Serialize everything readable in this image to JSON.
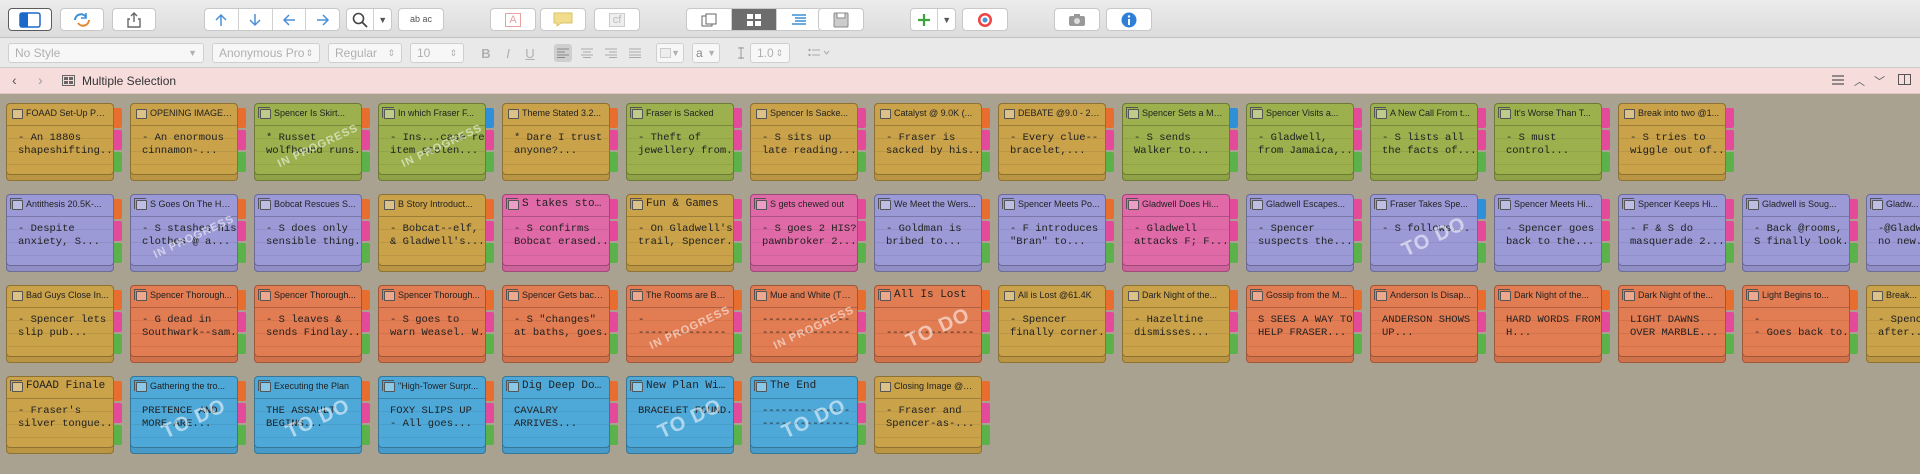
{
  "toolbar": {
    "find_replace_label": "ab ac",
    "text_color_label": "A",
    "comment_label": "",
    "footnote_label": "cf"
  },
  "formatbar": {
    "style": "No Style",
    "font": "Anonymous Pro",
    "weight": "Regular",
    "size": "10",
    "line_spacing": "1.0",
    "bold": "B",
    "italic": "I",
    "underline": "U",
    "color_label": "a"
  },
  "navbar": {
    "title": "Multiple Selection"
  },
  "colors": {
    "yellow": "#c9a24a",
    "green": "#9cb04e",
    "purple": "#9b9ad6",
    "pink": "#e06aa8",
    "orange": "#e27c52",
    "blue": "#4ea9d9",
    "tab_orange": "#e76e2e",
    "tab_pink": "#e34b9a",
    "tab_green": "#5bb24a",
    "tab_blue": "#2f8fd8"
  },
  "cards": [
    [
      {
        "title": "FOAAD Set-Up Part...",
        "text": "- An 1880s\nshapeshifting...",
        "color": "yellow",
        "stamp": "",
        "big": false,
        "tabs": [
          "tab_orange",
          "tab_pink",
          "tab_green"
        ]
      },
      {
        "title": "OPENING IMAGE (Th...",
        "text": "- An enormous\ncinnamon-...",
        "color": "yellow",
        "stamp": "",
        "big": false,
        "tabs": [
          "tab_orange",
          "tab_pink",
          "tab_green"
        ]
      },
      {
        "title": "Spencer Is Skirt...",
        "text": "* Russet\nwolfhound runs...",
        "color": "green",
        "stamp": "IN PROGRESS",
        "big": false,
        "tabs": [
          "tab_orange",
          "tab_pink",
          "tab_green"
        ]
      },
      {
        "title": "In which Fraser F...",
        "text": "- Ins...case re:\nitem stolen...",
        "color": "green",
        "stamp": "IN PROGRESS",
        "big": false,
        "tabs": [
          "tab_blue",
          "tab_pink",
          "tab_green"
        ]
      },
      {
        "title": "Theme Stated 3.2...",
        "text": "* Dare I trust\nanyone?...",
        "color": "yellow",
        "stamp": "",
        "big": false,
        "tabs": [
          "tab_orange",
          "tab_pink",
          "tab_green"
        ]
      },
      {
        "title": "Fraser is Sacked",
        "text": "- Theft of\njewellery from...",
        "color": "green",
        "stamp": "",
        "big": false,
        "tabs": [
          "tab_pink",
          "tab_pink",
          "tab_green"
        ]
      },
      {
        "title": "Spencer Is Sacke...",
        "text": "- S sits up\nlate reading...",
        "color": "yellow",
        "stamp": "",
        "big": false,
        "tabs": [
          "tab_pink",
          "tab_pink",
          "tab_green"
        ]
      },
      {
        "title": "Catalyst @ 9.0K (...",
        "text": "- Fraser is\nsacked by his...",
        "color": "yellow",
        "stamp": "",
        "big": false,
        "tabs": [
          "tab_orange",
          "tab_pink",
          "tab_green"
        ]
      },
      {
        "title": "DEBATE @9.0 - 20...",
        "text": "- Every clue--\nbracelet,...",
        "color": "yellow",
        "stamp": "",
        "big": false,
        "tabs": [
          "tab_orange",
          "tab_pink",
          "tab_green"
        ]
      },
      {
        "title": "Spencer Sets a Mo...",
        "text": "- S sends\nWalker to...",
        "color": "green",
        "stamp": "",
        "big": false,
        "tabs": [
          "tab_blue",
          "tab_pink",
          "tab_green"
        ]
      },
      {
        "title": "Spencer Visits a...",
        "text": "- Gladwell,\nfrom Jamaica,...",
        "color": "green",
        "stamp": "",
        "big": false,
        "tabs": [
          "tab_pink",
          "tab_pink",
          "tab_green"
        ]
      },
      {
        "title": "A New Call From t...",
        "text": "- S lists all\nthe facts of...",
        "color": "green",
        "stamp": "",
        "big": false,
        "tabs": [
          "tab_pink",
          "tab_pink",
          "tab_green"
        ]
      },
      {
        "title": "It's Worse Than T...",
        "text": "- S must\ncontrol...",
        "color": "green",
        "stamp": "",
        "big": false,
        "tabs": [
          "tab_pink",
          "tab_pink",
          "tab_green"
        ]
      },
      {
        "title": "Break into two @1...",
        "text": "- S tries to\nwiggle out of...",
        "color": "yellow",
        "stamp": "",
        "big": false,
        "tabs": [
          "tab_pink",
          "tab_pink",
          "tab_green"
        ]
      }
    ],
    [
      {
        "title": "Antithesis 20.5K-...",
        "text": "- Despite\nanxiety, S...",
        "color": "purple",
        "stamp": "",
        "big": false,
        "tabs": [
          "tab_orange",
          "tab_pink",
          "tab_green"
        ]
      },
      {
        "title": "S Goes On The Hu...",
        "text": "- S stashes his\nclothes @ a...",
        "color": "purple",
        "stamp": "IN PROGRESS",
        "big": false,
        "tabs": [
          "tab_orange",
          "tab_pink",
          "tab_green"
        ]
      },
      {
        "title": "Bobcat Rescues S...",
        "text": "- S does only\nsensible thing...",
        "color": "purple",
        "stamp": "",
        "big": false,
        "tabs": [
          "tab_orange",
          "tab_pink",
          "tab_green"
        ]
      },
      {
        "title": "B Story Introduct...",
        "text": "- Bobcat--elf,\n& Gladwell's...",
        "color": "yellow",
        "stamp": "",
        "big": false,
        "tabs": [
          "tab_orange",
          "tab_pink",
          "tab_green"
        ]
      },
      {
        "title": "S takes stock",
        "text": "- S confirms\nBobcat erased...",
        "color": "pink",
        "stamp": "",
        "big": true,
        "tabs": [
          "tab_pink",
          "tab_pink",
          "tab_green"
        ]
      },
      {
        "title": "Fun & Games",
        "text": "- On Gladwell's\ntrail, Spencer...",
        "color": "yellow",
        "stamp": "",
        "big": true,
        "tabs": [
          "tab_pink",
          "tab_pink",
          "tab_green"
        ]
      },
      {
        "title": "S gets chewed out",
        "text": "- S goes 2 HIS?\npawnbroker 2...",
        "color": "pink",
        "stamp": "",
        "big": false,
        "tabs": [
          "tab_pink",
          "tab_pink",
          "tab_green"
        ]
      },
      {
        "title": "We Meet the Wers...",
        "text": "- Goldman is\nbribed to...",
        "color": "purple",
        "stamp": "",
        "big": false,
        "tabs": [
          "tab_orange",
          "tab_pink",
          "tab_green"
        ]
      },
      {
        "title": "Spencer Meets Po...",
        "text": "- F introduces\n\"Bran\" to...",
        "color": "purple",
        "stamp": "",
        "big": false,
        "tabs": [
          "tab_orange",
          "tab_pink",
          "tab_green"
        ]
      },
      {
        "title": "Gladwell Does Hi...",
        "text": "- Gladwell\nattacks F; F...",
        "color": "pink",
        "stamp": "",
        "big": false,
        "tabs": [
          "tab_pink",
          "tab_pink",
          "tab_green"
        ]
      },
      {
        "title": "Gladwell Escapes...",
        "text": "- Spencer\nsuspects the...",
        "color": "purple",
        "stamp": "",
        "big": false,
        "tabs": [
          "tab_pink",
          "tab_pink",
          "tab_green"
        ]
      },
      {
        "title": "Fraser Takes Spe...",
        "text": "- S follows...",
        "color": "purple",
        "stamp": "TO DO",
        "big": false,
        "tabs": [
          "tab_blue",
          "tab_pink",
          "tab_green"
        ]
      },
      {
        "title": "Spencer Meets Hi...",
        "text": "- Spencer goes\nback to the...",
        "color": "purple",
        "stamp": "",
        "big": false,
        "tabs": [
          "tab_pink",
          "tab_pink",
          "tab_green"
        ]
      },
      {
        "title": "Spencer Keeps Hi...",
        "text": "- F & S do\nmasquerade 2...",
        "color": "purple",
        "stamp": "",
        "big": false,
        "tabs": [
          "tab_pink",
          "tab_pink",
          "tab_green"
        ]
      },
      {
        "title": "Gladwell is Soug...",
        "text": "- Back @rooms,\nS finally look...",
        "color": "purple",
        "stamp": "",
        "big": false,
        "tabs": [
          "tab_pink",
          "tab_pink",
          "tab_green"
        ]
      },
      {
        "title": "Gladw...",
        "text": "-@Gladw\nno new...",
        "color": "purple",
        "stamp": "",
        "big": false,
        "tabs": []
      }
    ],
    [
      {
        "title": "Bad Guys Close In...",
        "text": "- Spencer lets\nslip pub...",
        "color": "yellow",
        "stamp": "",
        "big": false,
        "tabs": [
          "tab_orange",
          "tab_pink",
          "tab_green"
        ]
      },
      {
        "title": "Spencer Thorough...",
        "text": "- G dead in\nSouthwark--sam...",
        "color": "orange",
        "stamp": "",
        "big": false,
        "tabs": [
          "tab_orange",
          "tab_pink",
          "tab_green"
        ]
      },
      {
        "title": "Spencer Thorough...",
        "text": "- S leaves &\nsends Findlay...",
        "color": "orange",
        "stamp": "",
        "big": false,
        "tabs": [
          "tab_orange",
          "tab_pink",
          "tab_green"
        ]
      },
      {
        "title": "Spencer Thorough...",
        "text": "- S goes to\nwarn Weasel. W...",
        "color": "orange",
        "stamp": "",
        "big": false,
        "tabs": [
          "tab_orange",
          "tab_pink",
          "tab_green"
        ]
      },
      {
        "title": "Spencer Gets back...",
        "text": "- S \"changes\"\nat baths, goes...",
        "color": "orange",
        "stamp": "",
        "big": false,
        "tabs": [
          "tab_orange",
          "tab_pink",
          "tab_green"
        ]
      },
      {
        "title": "The Rooms are Bur...",
        "text": "-\n--------------",
        "color": "orange",
        "stamp": "IN PROGRESS",
        "big": false,
        "tabs": [
          "tab_orange",
          "tab_pink",
          "tab_green"
        ]
      },
      {
        "title": "Mue and White (Th...",
        "text": "--------------\n--------------",
        "color": "orange",
        "stamp": "IN PROGRESS",
        "big": false,
        "tabs": [
          "tab_orange",
          "tab_pink",
          "tab_green"
        ]
      },
      {
        "title": "All Is Lost",
        "text": "\n--------------",
        "color": "orange",
        "stamp": "TO DO",
        "big": true,
        "tabs": [
          "tab_orange",
          "tab_pink",
          "tab_green"
        ]
      },
      {
        "title": "All is Lost @61.4K",
        "text": "- Spencer\nfinally corner...",
        "color": "yellow",
        "stamp": "",
        "big": false,
        "tabs": [
          "tab_orange",
          "tab_pink",
          "tab_green"
        ]
      },
      {
        "title": "Dark Night of the...",
        "text": "- Hazeltine\ndismisses...",
        "color": "yellow",
        "stamp": "",
        "big": false,
        "tabs": [
          "tab_orange",
          "tab_pink",
          "tab_green"
        ]
      },
      {
        "title": "Gossip from the M...",
        "text": "S SEES A WAY TO\nHELP FRASER...",
        "color": "orange",
        "stamp": "",
        "big": false,
        "tabs": [
          "tab_orange",
          "tab_pink",
          "tab_green"
        ]
      },
      {
        "title": "Anderson Is Disap...",
        "text": "ANDERSON SHOWS\nUP...",
        "color": "orange",
        "stamp": "",
        "big": false,
        "tabs": [
          "tab_orange",
          "tab_pink",
          "tab_green"
        ]
      },
      {
        "title": "Dark Night of the...",
        "text": "HARD WORDS FROM\nH...",
        "color": "orange",
        "stamp": "",
        "big": false,
        "tabs": [
          "tab_orange",
          "tab_pink",
          "tab_green"
        ]
      },
      {
        "title": "Dark Night of the...",
        "text": "LIGHT DAWNS\nOVER MARBLE...",
        "color": "orange",
        "stamp": "",
        "big": false,
        "tabs": [
          "tab_orange",
          "tab_pink",
          "tab_green"
        ]
      },
      {
        "title": "Light Begins to...",
        "text": "-\n- Goes back to...",
        "color": "orange",
        "stamp": "",
        "big": false,
        "tabs": [
          "tab_orange",
          "tab_pink",
          "tab_green"
        ]
      },
      {
        "title": "Break...",
        "text": "- Spenc\nafter...",
        "color": "yellow",
        "stamp": "",
        "big": false,
        "tabs": []
      }
    ],
    [
      {
        "title": "FOAAD Finale",
        "text": "- Fraser's\nsilver tongue...",
        "color": "yellow",
        "stamp": "",
        "big": true,
        "tabs": [
          "tab_orange",
          "tab_pink",
          "tab_green"
        ]
      },
      {
        "title": "Gathering the tro...",
        "text": "PRETENCE AND\nMORE ARE...",
        "color": "blue",
        "stamp": "TO DO",
        "big": false,
        "tabs": [
          "tab_orange",
          "tab_pink",
          "tab_green"
        ]
      },
      {
        "title": "Executing the Plan",
        "text": "THE ASSAULT\nBEGINS...",
        "color": "blue",
        "stamp": "TO DO",
        "big": false,
        "tabs": [
          "tab_orange",
          "tab_pink",
          "tab_green"
        ]
      },
      {
        "title": "\"High-Tower Surpr...",
        "text": "FOXY SLIPS UP\n- All goes...",
        "color": "blue",
        "stamp": "",
        "big": false,
        "tabs": [
          "tab_orange",
          "tab_pink",
          "tab_green"
        ]
      },
      {
        "title": "Dig Deep Down",
        "text": "CAVALRY\nARRIVES...",
        "color": "blue",
        "stamp": "",
        "big": true,
        "tabs": [
          "tab_orange",
          "tab_pink",
          "tab_green"
        ]
      },
      {
        "title": "New Plan Wins",
        "text": "BRACELET FOUND...",
        "color": "blue",
        "stamp": "TO DO",
        "big": true,
        "tabs": [
          "tab_orange",
          "tab_pink",
          "tab_green"
        ]
      },
      {
        "title": "The End",
        "text": "--------------\n--------------",
        "color": "blue",
        "stamp": "TO DO",
        "big": true,
        "tabs": [
          "tab_orange",
          "tab_pink",
          "tab_green"
        ]
      },
      {
        "title": "Closing Image @90...",
        "text": "- Fraser and\nSpencer-as-...",
        "color": "yellow",
        "stamp": "",
        "big": false,
        "tabs": [
          "tab_orange",
          "tab_pink",
          "tab_green"
        ]
      }
    ]
  ]
}
